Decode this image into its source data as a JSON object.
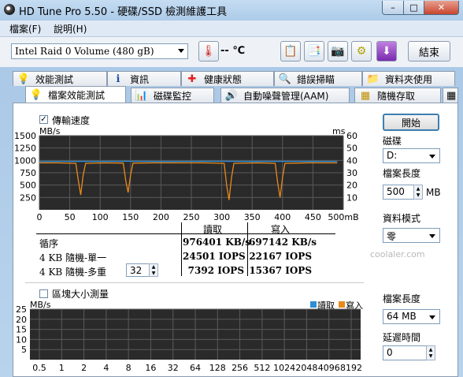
{
  "window": {
    "title": "HD Tune Pro 5.50 - 硬碟/SSD 檢測維護工具",
    "minimize": "–",
    "maximize": "□",
    "close": "✕"
  },
  "menu": {
    "items": [
      "檔案(F)",
      "說明(H)"
    ]
  },
  "toolbar": {
    "drive": "Intel   Raid 0 Volume (480 gB)",
    "temperature": "-- ℃",
    "icons": [
      "copy-info-icon",
      "copy-all-icon",
      "screenshot-icon",
      "options-icon",
      "save-icon"
    ],
    "exit_label": "結束"
  },
  "tabs_row1": [
    {
      "label": "效能測試",
      "icon": "benchmark-icon"
    },
    {
      "label": "資訊",
      "icon": "info-icon"
    },
    {
      "label": "健康狀態",
      "icon": "health-icon"
    },
    {
      "label": "錯誤掃瞄",
      "icon": "error-scan-icon"
    },
    {
      "label": "資料夾使用",
      "icon": "folder-usage-icon"
    }
  ],
  "tabs_row2": [
    {
      "label": "檔案效能測試",
      "icon": "file-benchmark-icon",
      "active": true
    },
    {
      "label": "磁碟監控",
      "icon": "disk-monitor-icon"
    },
    {
      "label": "自動噪聲管理(AAM)",
      "icon": "aam-icon"
    },
    {
      "label": "隨機存取",
      "icon": "random-access-icon"
    }
  ],
  "transfer": {
    "checkbox_label": "傳輸速度",
    "checked": true,
    "y_unit_left": "MB/s",
    "y_unit_right": "ms",
    "table": {
      "headers": [
        "讀取",
        "寫入"
      ],
      "rows": [
        {
          "label": "循序",
          "read": "976401 KB/s",
          "write": "697142 KB/s"
        },
        {
          "label": "4 KB 隨機-單一",
          "read": "24501 IOPS",
          "write": "22167 IOPS"
        },
        {
          "label": "4 KB 隨機-多重",
          "read": "7392 IOPS",
          "write": "15367 IOPS",
          "queue": "32"
        }
      ]
    }
  },
  "block": {
    "checkbox_label": "區塊大小測量",
    "checked": false,
    "y_unit": "MB/s",
    "legend": [
      "讀取",
      "寫入"
    ]
  },
  "right_panel": {
    "start_label": "開始",
    "disk_label": "磁碟",
    "disk_value": "D:",
    "file_length_label": "檔案長度",
    "file_length_value": "500",
    "file_length_unit": "MB",
    "data_mode_label": "資料模式",
    "data_mode_value": "零",
    "file_length2_label": "檔案長度",
    "file_length2_value": "64 MB",
    "delay_label": "延遲時間",
    "delay_value": "0"
  },
  "watermark": "coolaler.com",
  "colors": {
    "read": "#2f8fd6",
    "write": "#e98a1c",
    "chart_bg": "#2a2a2a",
    "grid": "#5a5a5a"
  },
  "chart_data": [
    {
      "type": "line",
      "title": "傳輸速度",
      "xlabel": "",
      "ylabel": "MB/s",
      "x_ticks": [
        0,
        50,
        100,
        150,
        200,
        250,
        300,
        350,
        400,
        450,
        500
      ],
      "x_tick_labels": [
        "0",
        "50",
        "100",
        "150",
        "200",
        "250",
        "300",
        "350",
        "400",
        "450",
        "500mB"
      ],
      "y_ticks_left": [
        "250",
        "500",
        "750",
        "1000",
        "1250",
        "1500"
      ],
      "y_ticks_right": [
        "10",
        "20",
        "30",
        "40",
        "50",
        "60"
      ],
      "xlim": [
        0,
        500
      ],
      "ylim": [
        0,
        1500
      ],
      "grid": true,
      "series": [
        {
          "name": "讀取",
          "color": "#2f8fd6",
          "x": [
            0,
            50,
            100,
            150,
            200,
            250,
            300,
            350,
            400,
            450,
            490
          ],
          "y": [
            975,
            980,
            978,
            982,
            976,
            979,
            981,
            977,
            980,
            978,
            979
          ]
        },
        {
          "name": "寫入",
          "color": "#e98a1c",
          "x": [
            0,
            30,
            60,
            64,
            68,
            72,
            76,
            110,
            138,
            142,
            146,
            150,
            154,
            190,
            230,
            270,
            304,
            308,
            312,
            316,
            320,
            360,
            388,
            392,
            396,
            400,
            404,
            440,
            490
          ],
          "y": [
            950,
            950,
            940,
            600,
            300,
            700,
            940,
            950,
            945,
            600,
            350,
            700,
            945,
            950,
            950,
            950,
            940,
            500,
            200,
            650,
            940,
            950,
            940,
            550,
            250,
            650,
            940,
            950,
            950
          ]
        }
      ]
    },
    {
      "type": "bar",
      "title": "區塊大小測量",
      "ylabel": "MB/s",
      "categories": [
        "0.5",
        "1",
        "2",
        "4",
        "8",
        "16",
        "32",
        "64",
        "128",
        "256",
        "512",
        "1024",
        "2048",
        "4096",
        "8192"
      ],
      "y_ticks": [
        "5",
        "10",
        "15",
        "20",
        "25"
      ],
      "ylim": [
        0,
        25
      ],
      "grid": true,
      "series": [
        {
          "name": "讀取",
          "values": []
        },
        {
          "name": "寫入",
          "values": []
        }
      ]
    }
  ]
}
